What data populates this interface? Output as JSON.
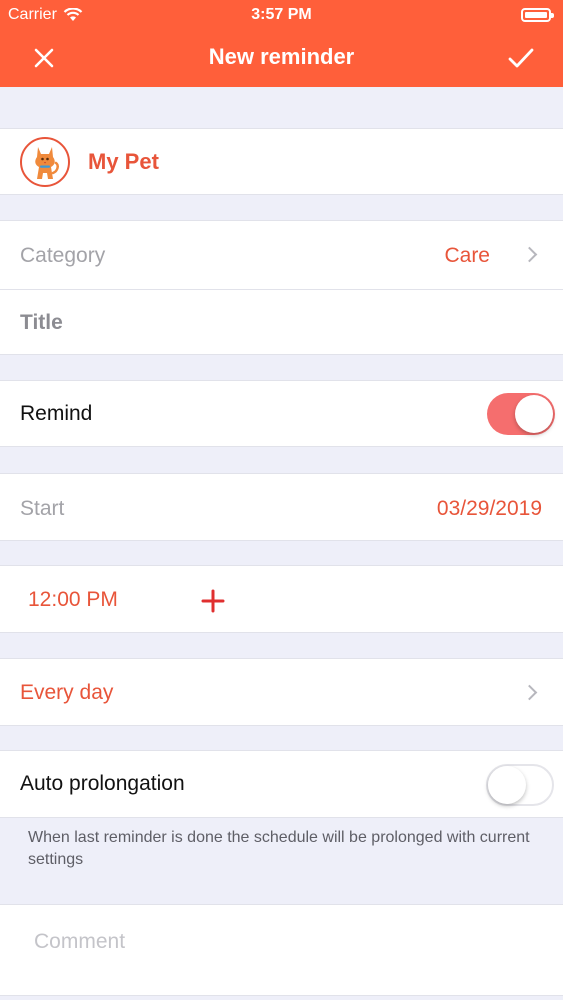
{
  "status_bar": {
    "carrier": "Carrier",
    "time": "3:57 PM"
  },
  "nav": {
    "title": "New reminder",
    "close_icon": "close-icon",
    "done_icon": "checkmark-icon"
  },
  "pet": {
    "name": "My Pet",
    "avatar_icon": "cat-icon"
  },
  "category": {
    "label": "Category",
    "value": "Care"
  },
  "title_field": {
    "placeholder": "Title"
  },
  "remind": {
    "label": "Remind",
    "enabled": true
  },
  "start": {
    "label": "Start",
    "value": "03/29/2019"
  },
  "time": {
    "value": "12:00 PM",
    "add_icon": "plus-icon"
  },
  "repeat": {
    "value": "Every day"
  },
  "auto_prolongation": {
    "label": "Auto prolongation",
    "enabled": false,
    "note": "When last reminder is done the schedule will be prolonged with current settings"
  },
  "comment": {
    "placeholder": "Comment"
  },
  "colors": {
    "accent": "#FF5F3A",
    "value_text": "#E8553A",
    "toggle_on": "#F56E6E",
    "background": "#EEEFF9"
  }
}
